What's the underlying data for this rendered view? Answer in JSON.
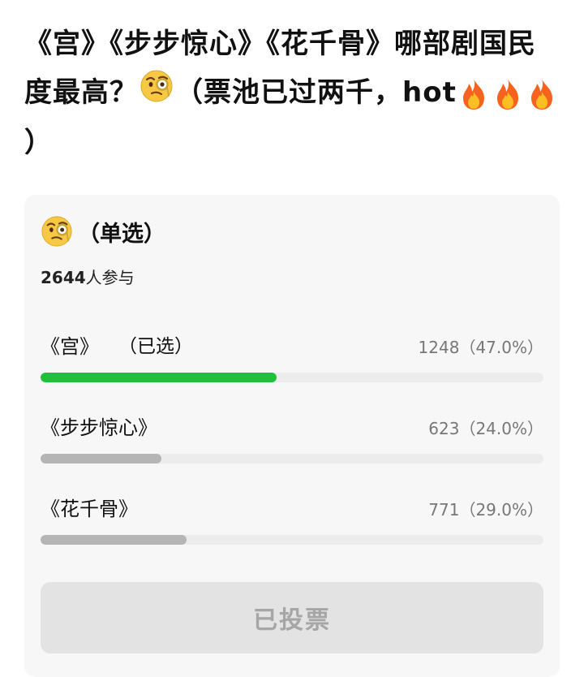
{
  "post": {
    "title_part1": "《宫》《步步惊心》《花千骨》哪部剧国民度最高？",
    "title_part2": "（票池已过两千，hot",
    "title_part3": "）",
    "title_emoji": "monocle-face-icon",
    "title_fire_icons": [
      "fire-icon",
      "fire-icon",
      "fire-icon"
    ]
  },
  "poll": {
    "type_label": "（单选）",
    "header_emoji": "monocle-face-icon",
    "participants_count": "2644",
    "participants_suffix": "人参与",
    "options": [
      {
        "label": "《宫》",
        "selected_tag": "（已选）",
        "votes": "1248",
        "percent_text": "（47.0%）",
        "share": 0.47,
        "selected": true
      },
      {
        "label": "《步步惊心》",
        "votes": "623",
        "percent_text": "（24.0%）",
        "share": 0.24,
        "selected": false
      },
      {
        "label": "《花千骨》",
        "votes": "771",
        "percent_text": "（29.0%）",
        "share": 0.29,
        "selected": false
      }
    ],
    "vote_button_label": "已投票"
  },
  "colors": {
    "selected_bar": "#1ec139",
    "unselected_bar": "#b5b5b5",
    "track": "#ececec",
    "card_background": "#f7f7f7",
    "button_background": "#e3e3e3",
    "button_text": "#a6a6a6"
  }
}
